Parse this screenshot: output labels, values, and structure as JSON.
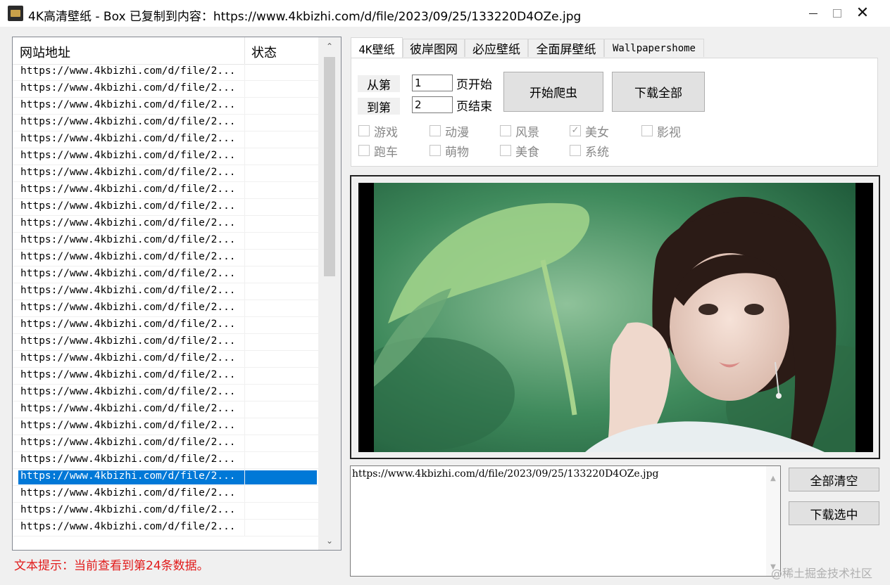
{
  "window": {
    "title": "4K高清壁纸 - Box   已复制到内容：https://www.4kbizhi.com/d/file/2023/09/25/133220D4OZe.jpg",
    "minimize_icon": "minimize-icon",
    "maximize_icon": "maximize-icon",
    "close_icon": "close-icon"
  },
  "list": {
    "headers": [
      "网站地址",
      "状态"
    ],
    "rows": [
      "https://www.4kbizhi.com/d/file/2...",
      "https://www.4kbizhi.com/d/file/2...",
      "https://www.4kbizhi.com/d/file/2...",
      "https://www.4kbizhi.com/d/file/2...",
      "https://www.4kbizhi.com/d/file/2...",
      "https://www.4kbizhi.com/d/file/2...",
      "https://www.4kbizhi.com/d/file/2...",
      "https://www.4kbizhi.com/d/file/2...",
      "https://www.4kbizhi.com/d/file/2...",
      "https://www.4kbizhi.com/d/file/2...",
      "https://www.4kbizhi.com/d/file/2...",
      "https://www.4kbizhi.com/d/file/2...",
      "https://www.4kbizhi.com/d/file/2...",
      "https://www.4kbizhi.com/d/file/2...",
      "https://www.4kbizhi.com/d/file/2...",
      "https://www.4kbizhi.com/d/file/2...",
      "https://www.4kbizhi.com/d/file/2...",
      "https://www.4kbizhi.com/d/file/2...",
      "https://www.4kbizhi.com/d/file/2...",
      "https://www.4kbizhi.com/d/file/2...",
      "https://www.4kbizhi.com/d/file/2...",
      "https://www.4kbizhi.com/d/file/2...",
      "https://www.4kbizhi.com/d/file/2...",
      "https://www.4kbizhi.com/d/file/2...",
      "https://www.4kbizhi.com/d/file/2...",
      "https://www.4kbizhi.com/d/file/2...",
      "https://www.4kbizhi.com/d/file/2...",
      "https://www.4kbizhi.com/d/file/2..."
    ],
    "selected_index": 24,
    "scroll_up_icon": "chevron-up-icon",
    "scroll_down_icon": "chevron-down-icon"
  },
  "hint": "文本提示：当前查看到第24条数据。",
  "tabs": [
    "4K壁纸",
    "彼岸图网",
    "必应壁纸",
    "全面屏壁纸",
    "Wallpapershome"
  ],
  "active_tab": 0,
  "controls": {
    "from_label": "从第",
    "from_value": "1",
    "from_suffix": "页开始",
    "to_label": "到第",
    "to_value": "2",
    "to_suffix": "页结束",
    "start_button": "开始爬虫",
    "download_all_button": "下载全部"
  },
  "categories": [
    {
      "label": "游戏",
      "checked": false
    },
    {
      "label": "动漫",
      "checked": false
    },
    {
      "label": "风景",
      "checked": false
    },
    {
      "label": "美女",
      "checked": true
    },
    {
      "label": "影视",
      "checked": false
    },
    {
      "label": "跑车",
      "checked": false
    },
    {
      "label": "萌物",
      "checked": false
    },
    {
      "label": "美食",
      "checked": false
    },
    {
      "label": "系统",
      "checked": false
    }
  ],
  "output": {
    "text": "https://www.4kbizhi.com/d/file/2023/09/25/133220D4OZe.jpg"
  },
  "side_buttons": {
    "clear_all": "全部清空",
    "download_selected": "下载选中"
  },
  "watermark": "@稀土掘金技术社区",
  "colors": {
    "selection": "#0078d7",
    "hint_red": "#e11b1b"
  }
}
